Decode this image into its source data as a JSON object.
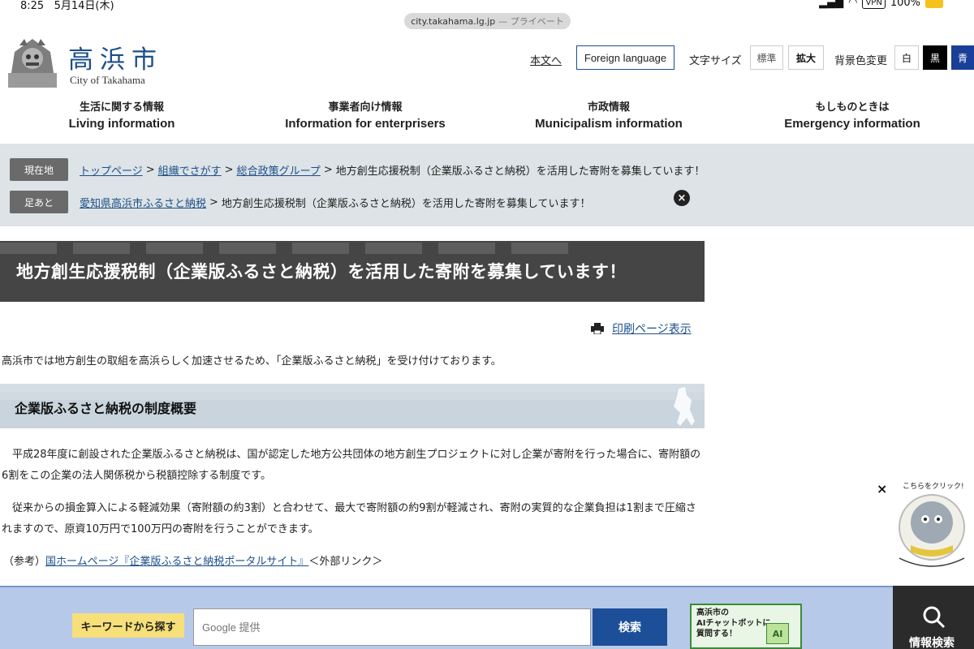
{
  "status": {
    "time": "8:25",
    "date": "5月14日(木)",
    "vpn": "VPN",
    "battery": "100%"
  },
  "url": {
    "host": "city.takahama.lg.jp",
    "privacy": "— プライベート"
  },
  "header": {
    "title": "高浜市",
    "subtitle": "City of Takahama",
    "skip_link": "本文へ",
    "foreign": "Foreign language",
    "font_size_label": "文字サイズ",
    "font_std": "標準",
    "font_big": "拡大",
    "bg_label": "背景色変更",
    "bg_white": "白",
    "bg_black": "黒",
    "bg_blue": "青"
  },
  "nav": [
    {
      "jp": "生活に関する情報",
      "en": "Living information"
    },
    {
      "jp": "事業者向け情報",
      "en": "Information for enterprisers"
    },
    {
      "jp": "市政情報",
      "en": "Municipalism information"
    },
    {
      "jp": "もしものときは",
      "en": "Emergency information"
    }
  ],
  "breadcrumb": {
    "current_tag": "現在地",
    "links": [
      "トップページ",
      "組織でさがす",
      "総合政策グループ"
    ],
    "current": "地方創生応援税制（企業版ふるさと納税）を活用した寄附を募集しています！",
    "history_tag": "足あと",
    "history_link": "愛知県高浜市ふるさと納税",
    "history_current": "地方創生応援税制（企業版ふるさと納税）を活用した寄附を募集しています！",
    "close": "×",
    "sep": ">"
  },
  "page": {
    "title": "地方創生応援税制（企業版ふるさと納税）を活用した寄附を募集しています！",
    "print": "印刷ページ表示",
    "intro": "高浜市では地方創生の取組を高浜らしく加速させるため、「企業版ふるさと納税」を受け付けております。",
    "section_title": "企業版ふるさと納税の制度概要",
    "p1": "　平成28年度に創設された企業版ふるさと納税は、国が認定した地方公共団体の地方創生プロジェクトに対し企業が寄附を行った場合に、寄附額の6割をこの企業の法人関係税から税額控除する制度です。",
    "p2": "　従来からの損金算入による軽減効果（寄附額の約3割）と合わせて、最大で寄附額の約9割が軽減され、寄附の実質的な企業負担は1割まで圧縮されますので、原資10万円で100万円の寄附を行うことができます。",
    "ref_prefix": "（参考）",
    "ref_link": "国ホームページ『企業版ふるさと納税ポータルサイト』",
    "ref_suffix": "＜外部リンク＞"
  },
  "mascot": {
    "close": "×",
    "caption": "こちらをクリック!"
  },
  "footer": {
    "keyword_label": "キーワードから探す",
    "search_placeholder": "Google 提供",
    "search_button": "検索",
    "chatbot_text": "高浜市の\nAIチャットボットに\n質問する！",
    "chatbot_ai": "AI",
    "info_search": "情報検索"
  }
}
